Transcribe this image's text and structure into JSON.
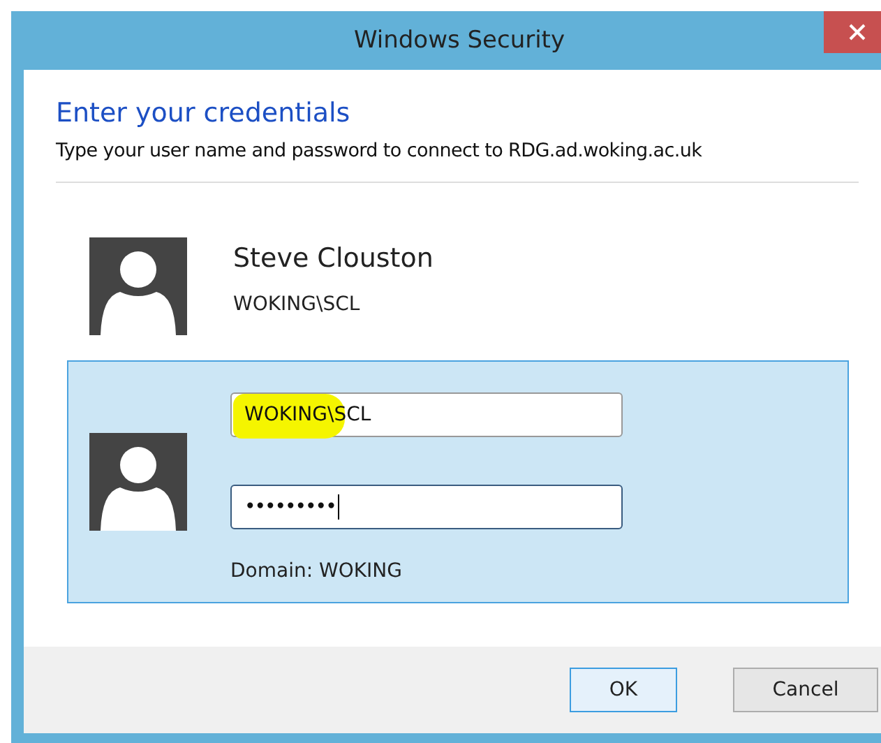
{
  "window": {
    "title": "Windows Security"
  },
  "header": {
    "title": "Enter your credentials",
    "subtitle": "Type your user name and password to connect to RDG.ad.woking.ac.uk"
  },
  "tiles": [
    {
      "kind": "account",
      "selected": false,
      "name": "Steve Clouston",
      "account": "WOKING\\SCL"
    },
    {
      "kind": "login",
      "selected": true,
      "username": {
        "value": "WOKING\\SCL",
        "highlighted": true
      },
      "password": {
        "value": "•••••••••",
        "focused": true
      },
      "domain": "Domain: WOKING"
    }
  ],
  "buttons": [
    {
      "label": "OK",
      "default": true
    },
    {
      "label": "Cancel",
      "default": false
    }
  ]
}
